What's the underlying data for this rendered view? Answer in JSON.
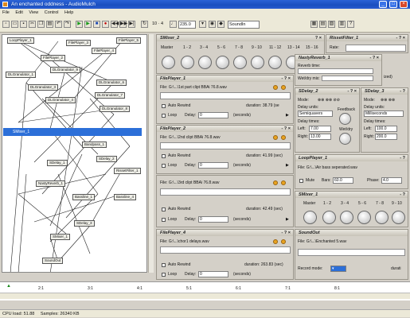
{
  "window": {
    "title": "An enchanted oddness - AudioMulch"
  },
  "menu": {
    "items": [
      "File",
      "Edit",
      "View",
      "Control",
      "Help"
    ]
  },
  "toolbar": {
    "time_sig": "10 · 4",
    "tempo": "235.0",
    "soundin": "SoundIn"
  },
  "graph_nodes": [
    "LoopPlayer_1",
    "FilePlayer_3",
    "FilePlayer_5",
    "FilePlayer_4",
    "FilePlayer_2",
    "DLGranulator_1",
    "DLGranulator_9",
    "DLGranulator_6",
    "DLGranulator_7",
    "DLGranulator_3",
    "DLGranulator_4",
    "DLGranulator_8",
    "Bandpass_1",
    "SDelay_1",
    "SDelay_2",
    "NastyReverb_1",
    "RissetFilter_1",
    "Bassline_1",
    "Bassline_4",
    "SDelay_3",
    "SMixer_1",
    "SoundOut"
  ],
  "graph_selected": "SMixer_1",
  "mixer2": {
    "title": "SMixer_2",
    "master_label": "Master",
    "channels": [
      "1 - 2",
      "3 - 4",
      "5 - 6",
      "7 - 8",
      "9 - 10",
      "11 - 12",
      "13 - 14",
      "15 - 16"
    ]
  },
  "fileplayers": [
    {
      "title": "FilePlayer_1",
      "file": "File:  G:\\...\\1st part clipt BBAi 76.8.wav",
      "auto_rewind": "Auto Rewind",
      "duration": "duration: 38.79 (se",
      "loop": "Loop",
      "delay_label": "Delay:",
      "delay": "0",
      "seconds": "(seconds)"
    },
    {
      "title": "FilePlayer_2",
      "file": "File:  G:\\...\\2nd clipt BBAi 76.8.wav",
      "auto_rewind": "Auto Rewind",
      "duration": "duration: 41.99 (sec)",
      "loop": "Loop",
      "delay_label": "Delay:",
      "delay": "0",
      "seconds": "(seconds)"
    },
    {
      "title": "",
      "file": "File:  G:\\...\\3rd clipt BBAi 76.8.wav",
      "auto_rewind": "Auto Rewind",
      "duration": "duration: 42.49 (sec)",
      "loop": "Loop",
      "delay_label": "Delay:",
      "delay": "0",
      "seconds": "(seconds)"
    },
    {
      "title": "FilePlayer_4",
      "file": "File:  G:\\...\\chor1 delays.wav",
      "auto_rewind": "Auto Rewind",
      "duration": "duration: 263.83 (sec)",
      "loop": "Loop",
      "delay_label": "Delay:",
      "delay": "0",
      "seconds": "(seconds)"
    }
  ],
  "risset": {
    "title": "RissetFilter_1",
    "rate_label": "Rate:"
  },
  "nasty": {
    "title": "NastyReverb_1",
    "reverb_time": "Reverb time:",
    "wet_dry": "Wet/dry mix:",
    "partial": "ized)"
  },
  "sdelay2": {
    "title": "SDelay_2",
    "mode": "Mode:",
    "delay_units": "Delay units:",
    "units": "Semiquavers",
    "feedback": "Feedback",
    "delay_times": "Delay times:",
    "left": "Left:",
    "left_val": "7.00",
    "right": "Right:",
    "right_val": "13.00",
    "wet_dry": "Wet/dry"
  },
  "sdelay3": {
    "title": "SDelay_3",
    "mode": "Mode:",
    "delay_units": "Delay units:",
    "units": "Milliseconds",
    "delay_times": "Delay times:",
    "left": "Left:",
    "left_val": "100.0",
    "right": "Right:",
    "right_val": "200.0"
  },
  "loopplayer": {
    "title": "LoopPlayer_1",
    "file": "File:  G:\\...\\Air bass seperated.wav",
    "mute": "Mute",
    "bars_label": "Bars:",
    "bars": "60.0",
    "phase_label": "Phase:",
    "phase": "4.0"
  },
  "mixer1": {
    "title": "SMixer_1",
    "master_label": "Master",
    "channels": [
      "1 - 2",
      "3 - 4",
      "5 - 6",
      "7 - 8",
      "9 - 10"
    ]
  },
  "soundout": {
    "title": "SoundOut",
    "file": "File:  G:\\...\\Enchanted 5.wav",
    "record_mode": "Record mode:",
    "duration": "durati"
  },
  "timeline": {
    "ticks": [
      "2:1",
      "3:1",
      "4:1",
      "5:1",
      "6:1",
      "7:1",
      "8:1"
    ]
  },
  "status": {
    "cpu": "CPU load: 51.88",
    "samples": "Samples: 26340 KB"
  },
  "colors": {
    "titlebar": "#1a4fbf",
    "selected": "#2c6fd8",
    "background": "#d4d0c8"
  }
}
